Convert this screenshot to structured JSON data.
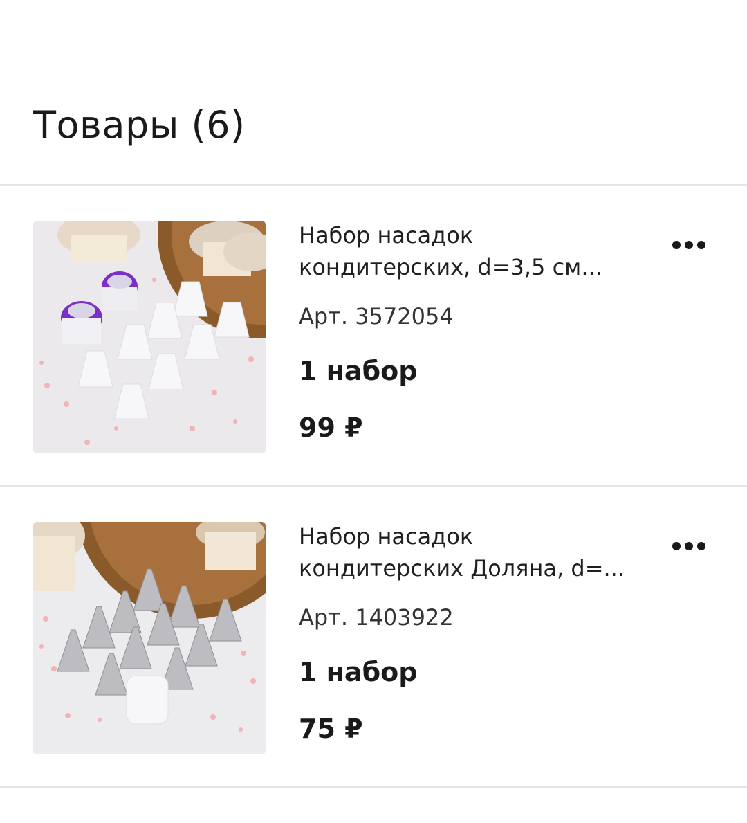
{
  "page": {
    "section_title": "Товары (6)"
  },
  "products": [
    {
      "name_line1": "Набор насадок",
      "name_line2": "кондитерских, d=3,5 см...",
      "article": "Арт. 3572054",
      "quantity": "1 набор",
      "price": "99 ₽",
      "image_icon": "piping-tips-plastic-image",
      "accent_color": "#8a2be2"
    },
    {
      "name_line1": "Набор насадок",
      "name_line2": "кондитерских Доляна, d=...",
      "article": "Арт. 1403922",
      "quantity": "1 набор",
      "price": "75 ₽",
      "image_icon": "piping-tips-metal-image",
      "accent_color": "#b8b8bc"
    }
  ],
  "icons": {
    "more": "more-horizontal-icon"
  }
}
